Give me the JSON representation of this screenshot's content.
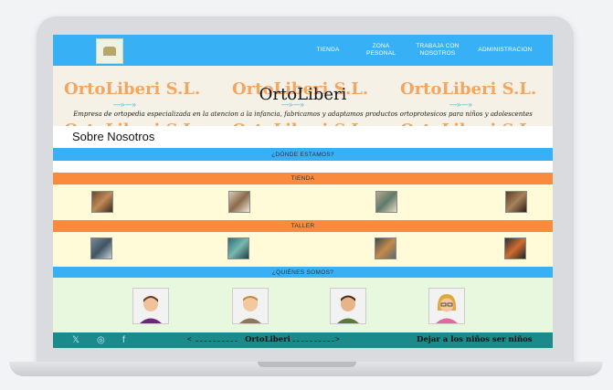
{
  "nav": {
    "items": [
      {
        "label": "TIENDA"
      },
      {
        "label": "ZONA PESONAL"
      },
      {
        "label": "TRABAJA CON NOSOTROS"
      },
      {
        "label": "ADMINISTRACION"
      }
    ]
  },
  "hero": {
    "watermark_text": "OrtoLiberi S.L.",
    "title": "OrtoLiberi",
    "subtitle": "Empresa de ortopedia especializada en la atencion a la infancia, fabricamos y adaptamos productos ortoprotesicos para niños y adolescentes"
  },
  "about": {
    "label": "Sobre Nosotros"
  },
  "sections": {
    "location": "¿DÓNDE ESTAMOS?",
    "store": "TIENDA",
    "workshop": "TALLER",
    "team": "¿QUIÉNES SOMOS?"
  },
  "footer": {
    "brand": "OrtoLiberi",
    "slogan": "Dejar a los niños ser niños",
    "social_icons": [
      "x-icon",
      "instagram-icon",
      "facebook-icon"
    ]
  },
  "colors": {
    "nav": "#38b0f5",
    "orange": "#fb8b3c",
    "footer": "#1a8a8a",
    "row_bg": "#fffbd9",
    "team_bg": "#e8f8de"
  }
}
